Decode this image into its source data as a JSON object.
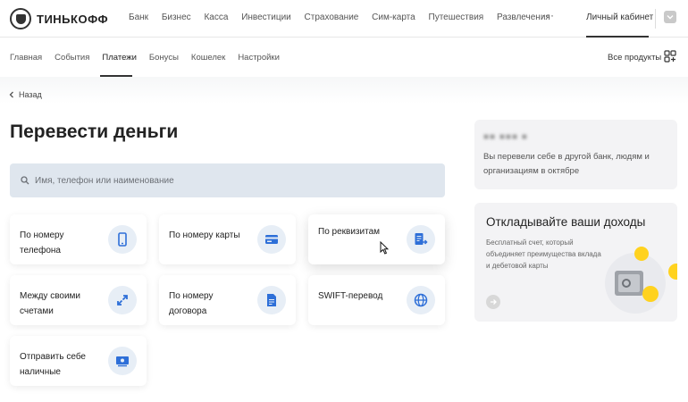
{
  "header": {
    "brand": "ТИНЬКОФФ",
    "nav": [
      "Банк",
      "Бизнес",
      "Касса",
      "Инвестиции",
      "Страхование",
      "Сим-карта",
      "Путешествия",
      "Развлечения"
    ],
    "more": "···",
    "cabinet": "Личный кабинет"
  },
  "subnav": {
    "items": [
      "Главная",
      "События",
      "Платежи",
      "Бонусы",
      "Кошелек",
      "Настройки"
    ],
    "active_index": 2,
    "all_products": "Все продукты"
  },
  "back_label": "Назад",
  "page_title": "Перевести деньги",
  "search": {
    "placeholder": "Имя, телефон или наименование",
    "value": ""
  },
  "cards": [
    {
      "label": "По номеру телефона",
      "icon": "phone-icon"
    },
    {
      "label": "По номеру карты",
      "icon": "card-icon"
    },
    {
      "label": "По реквизитам",
      "icon": "requisites-icon"
    },
    {
      "label": "Между своими счетами",
      "icon": "transfer-arrows-icon"
    },
    {
      "label": "По номеру договора",
      "icon": "document-icon"
    },
    {
      "label": "SWIFT-перевод",
      "icon": "globe-icon"
    },
    {
      "label": "Отправить себе наличные",
      "icon": "cash-icon"
    }
  ],
  "info": {
    "name": "■■ ■■■ ■",
    "text": "Вы перевели себе в другой банк, людям и организациям в октябре"
  },
  "promo": {
    "title": "Откладывайте ваши доходы",
    "text": "Бесплатный счет, который объединяет преимущества вклада и дебетовой карты"
  },
  "colors": {
    "accent": "#2e6fd8",
    "icon_bg": "#e7eef6",
    "search_bg": "#dfe6ee",
    "coin": "#ffd21f"
  }
}
